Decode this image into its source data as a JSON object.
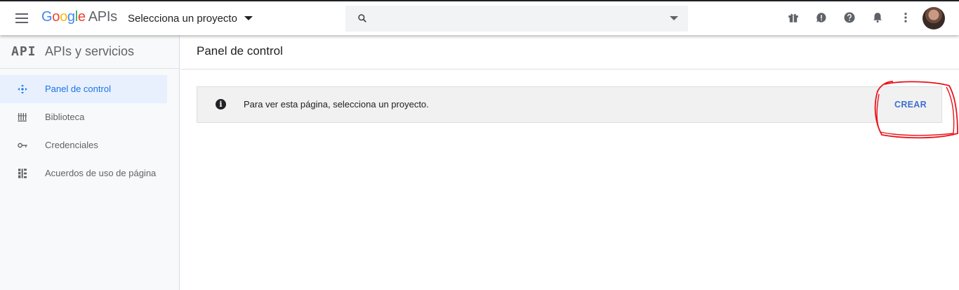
{
  "header": {
    "logo": {
      "g": "G",
      "o1": "o",
      "o2": "o",
      "g2": "g",
      "l": "l",
      "e": "e",
      "apis": "APIs"
    },
    "project_select_label": "Selecciona un proyecto",
    "search": {
      "value": "",
      "placeholder": ""
    },
    "icons": [
      "gift-icon",
      "feedback-icon",
      "help-icon",
      "notifications-icon",
      "more-vert-icon"
    ]
  },
  "sidebar": {
    "badge": "API",
    "title": "APIs y servicios",
    "items": [
      {
        "label": "Panel de control",
        "icon": "dashboard-icon",
        "active": true
      },
      {
        "label": "Biblioteca",
        "icon": "library-icon",
        "active": false
      },
      {
        "label": "Credenciales",
        "icon": "key-icon",
        "active": false
      },
      {
        "label": "Acuerdos de uso de página",
        "icon": "agreements-icon",
        "active": false
      }
    ]
  },
  "main": {
    "title": "Panel de control",
    "banner": {
      "message": "Para ver esta página, selecciona un proyecto.",
      "create_label": "CREAR"
    }
  },
  "colors": {
    "accent": "#1a73e8",
    "active_bg": "#e8f0fe",
    "annotation": "#e8141c",
    "create_text": "#3f6fd1"
  }
}
